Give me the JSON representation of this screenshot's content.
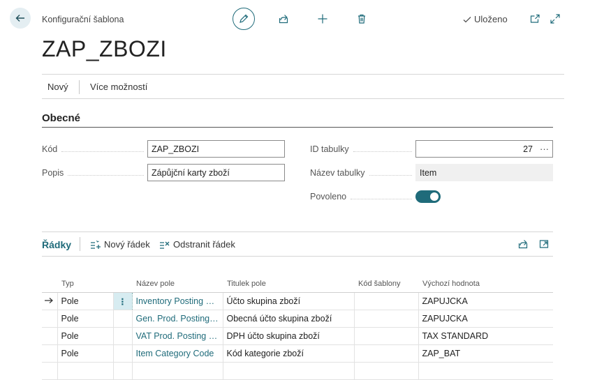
{
  "header": {
    "caption": "Konfigurační šablona",
    "title": "ZAP_ZBOZI",
    "saved_label": "Uloženo"
  },
  "menu": {
    "new_label": "Nový",
    "more_label": "Více možností"
  },
  "general": {
    "section_title": "Obecné",
    "code_label": "Kód",
    "code_value": "ZAP_ZBOZI",
    "description_label": "Popis",
    "description_value": "Zápůjční karty zboží",
    "table_id_label": "ID tabulky",
    "table_id_value": "27",
    "table_name_label": "Název tabulky",
    "table_name_value": "Item",
    "enabled_label": "Povoleno",
    "enabled_value": true
  },
  "lines": {
    "title": "Řádky",
    "new_line_label": "Nový řádek",
    "delete_line_label": "Odstranit řádek",
    "columns": [
      "Typ",
      "Název pole",
      "Titulek pole",
      "Kód šablony",
      "Výchozí hodnota"
    ],
    "rows": [
      {
        "type": "Pole",
        "field_name": "Inventory Posting G...",
        "field_caption": "Účto skupina zboží",
        "template_code": "",
        "default_value": "ZAPUJCKA"
      },
      {
        "type": "Pole",
        "field_name": "Gen. Prod. Posting ...",
        "field_caption": "Obecná účto skupina zboží",
        "template_code": "",
        "default_value": "ZAPUJCKA"
      },
      {
        "type": "Pole",
        "field_name": "VAT Prod. Posting G...",
        "field_caption": "DPH účto skupina zboží",
        "template_code": "",
        "default_value": "TAX STANDARD"
      },
      {
        "type": "Pole",
        "field_name": "Item Category Code",
        "field_caption": "Kód kategorie zboží",
        "template_code": "",
        "default_value": "ZAP_BAT"
      }
    ]
  },
  "colors": {
    "accent": "#1f6b7a",
    "selected_cell": "#d7ecf1"
  }
}
